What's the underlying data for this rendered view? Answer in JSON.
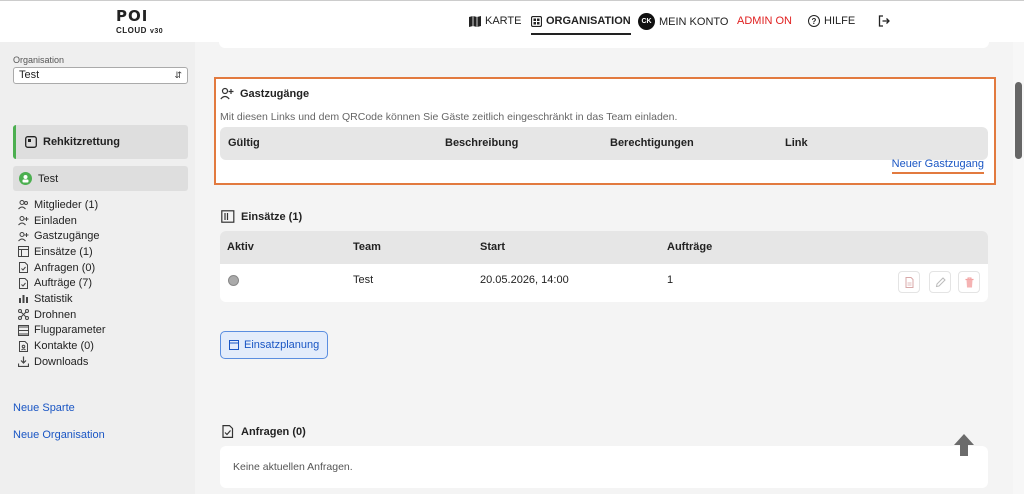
{
  "header": {
    "logo_main": "POI",
    "logo_sub": "CLOUD",
    "logo_version": "v30",
    "nav": {
      "karte": "KARTE",
      "organisation": "ORGANISATION",
      "avatar_initials": "CK",
      "mein_konto": "MEIN KONTO",
      "admin": "ADMIN ON",
      "hilfe": "HILFE"
    },
    "icons": [
      "map-icon",
      "grid-icon",
      "help-icon",
      "logout-icon"
    ]
  },
  "sidebar": {
    "org_label": "Organisation",
    "org_value": "Test",
    "sparte": "Rehkitzrettung",
    "team": "Test",
    "menu": [
      {
        "label": "Mitglieder (1)",
        "icon": "members-icon"
      },
      {
        "label": "Einladen",
        "icon": "invite-icon"
      },
      {
        "label": "Gastzugänge",
        "icon": "guest-access-icon"
      },
      {
        "label": "Einsätze (1)",
        "icon": "operations-icon"
      },
      {
        "label": "Anfragen (0)",
        "icon": "requests-icon"
      },
      {
        "label": "Aufträge (7)",
        "icon": "orders-icon"
      },
      {
        "label": "Statistik",
        "icon": "statistics-icon"
      },
      {
        "label": "Drohnen",
        "icon": "drone-icon"
      },
      {
        "label": "Flugparameter",
        "icon": "flight-params-icon"
      },
      {
        "label": "Kontakte (0)",
        "icon": "contacts-icon"
      },
      {
        "label": "Downloads",
        "icon": "download-icon"
      }
    ],
    "neue_sparte": "Neue Sparte",
    "neue_organisation": "Neue Organisation"
  },
  "gast": {
    "title": "Gastzugänge",
    "description": "Mit diesen Links und dem QRCode können Sie Gäste zeitlich eingeschränkt in das Team einladen.",
    "columns": [
      "Gültig",
      "Beschreibung",
      "Berechtigungen",
      "Link"
    ],
    "new_link": "Neuer Gastzugang",
    "accent": "#e27a3f"
  },
  "einsaetze": {
    "title": "Einsätze (1)",
    "columns": [
      "Aktiv",
      "Team",
      "Start",
      "Aufträge"
    ],
    "rows": [
      {
        "team": "Test",
        "start": "20.05.2026, 14:00",
        "auftraege": "1"
      }
    ],
    "plan_button": "Einsatzplanung"
  },
  "anfragen": {
    "title": "Anfragen (0)",
    "empty": "Keine aktuellen Anfragen."
  },
  "colors": {
    "link": "#1a56c4",
    "admin": "#e02020",
    "sparte_accent": "#4caf50"
  }
}
